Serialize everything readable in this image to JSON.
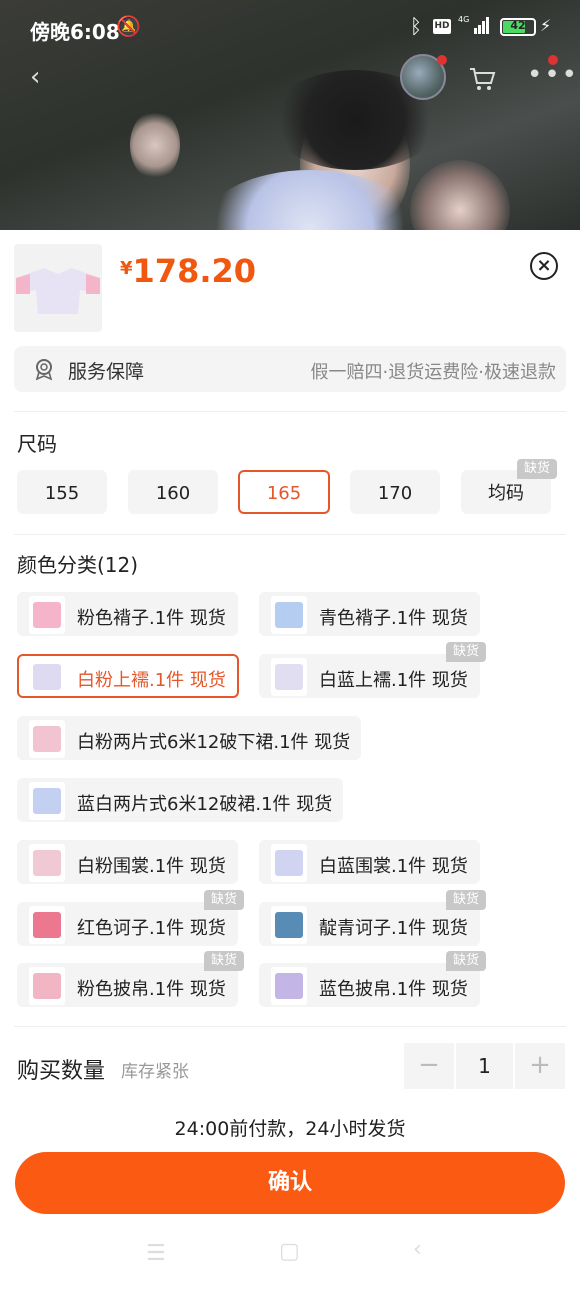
{
  "status_bar": {
    "time": "傍晚6:08",
    "network": "HD",
    "network_type": "4G",
    "battery": "42"
  },
  "product": {
    "currency_symbol": "¥",
    "price": "178.20"
  },
  "service": {
    "label": "服务保障",
    "value": "假一赔四·退货运费险·极速退款"
  },
  "size": {
    "title": "尺码",
    "options": [
      {
        "label": "155",
        "selected": false,
        "out_of_stock": false
      },
      {
        "label": "160",
        "selected": false,
        "out_of_stock": false
      },
      {
        "label": "165",
        "selected": true,
        "out_of_stock": false
      },
      {
        "label": "170",
        "selected": false,
        "out_of_stock": false
      },
      {
        "label": "均码",
        "selected": false,
        "out_of_stock": true
      }
    ]
  },
  "out_of_stock_label": "缺货",
  "color": {
    "title": "颜色分类(12)",
    "options": [
      {
        "label": "粉色褙子.1件 现货",
        "selected": false,
        "out_of_stock": false,
        "thumb_color": "#f3a7c0"
      },
      {
        "label": "青色褙子.1件 现货",
        "selected": false,
        "out_of_stock": false,
        "thumb_color": "#a7c4ee"
      },
      {
        "label": "白粉上襦.1件 现货",
        "selected": true,
        "out_of_stock": false,
        "thumb_color": "#d8d4ef"
      },
      {
        "label": "白蓝上襦.1件 现货",
        "selected": false,
        "out_of_stock": true,
        "thumb_color": "#dcd8ee"
      },
      {
        "label": "白粉两片式6米12破下裙.1件 现货",
        "selected": false,
        "out_of_stock": false,
        "thumb_color": "#f0b8c8"
      },
      {
        "label": "蓝白两片式6米12破裙.1件 现货",
        "selected": false,
        "out_of_stock": false,
        "thumb_color": "#b8c8ee"
      },
      {
        "label": "白粉围裳.1件 现货",
        "selected": false,
        "out_of_stock": false,
        "thumb_color": "#efc0cc"
      },
      {
        "label": "白蓝围裳.1件 现货",
        "selected": false,
        "out_of_stock": false,
        "thumb_color": "#c8ccee"
      },
      {
        "label": "红色诃子.1件 现货",
        "selected": false,
        "out_of_stock": true,
        "thumb_color": "#e8607a"
      },
      {
        "label": "靛青诃子.1件 现货",
        "selected": false,
        "out_of_stock": true,
        "thumb_color": "#3b78a8"
      },
      {
        "label": "粉色披帛.1件 现货",
        "selected": false,
        "out_of_stock": true,
        "thumb_color": "#f0a8b8"
      },
      {
        "label": "蓝色披帛.1件 现货",
        "selected": false,
        "out_of_stock": true,
        "thumb_color": "#b8a8e0"
      }
    ]
  },
  "quantity": {
    "label": "购买数量",
    "hint": "库存紧张",
    "value": "1",
    "minus": "−",
    "plus": "+"
  },
  "shipping": "24:00前付款，24小时发货",
  "confirm_label": "确认",
  "colors": {
    "accent": "#fb5a13",
    "selected_border": "#e4572a",
    "price": "#f0570f"
  }
}
